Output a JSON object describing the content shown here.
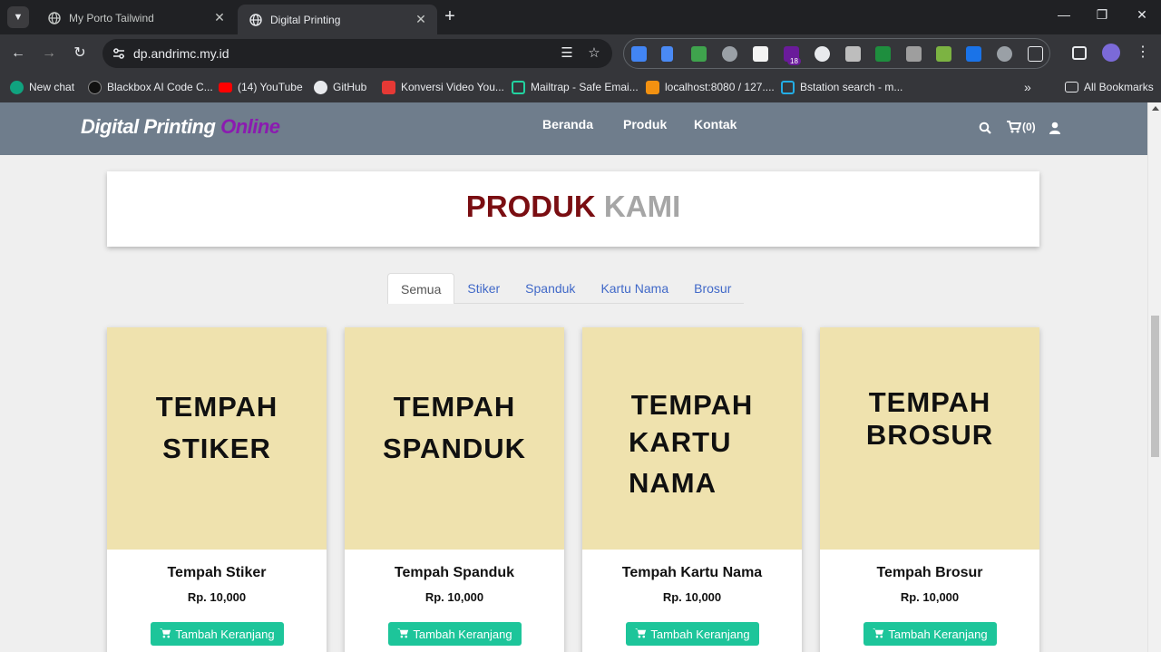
{
  "browser": {
    "tabs": [
      {
        "title": "My Porto Tailwind",
        "active": false
      },
      {
        "title": "Digital Printing",
        "active": true
      }
    ],
    "url": "dp.andrimc.my.id",
    "bookmarks": [
      {
        "label": "New chat",
        "color": "#10a37f"
      },
      {
        "label": "Blackbox AI Code C...",
        "color": "#111111"
      },
      {
        "label": "(14) YouTube",
        "color": "#ff0000"
      },
      {
        "label": "GitHub",
        "color": "#e8eaed"
      },
      {
        "label": "Konversi Video You...",
        "color": "#e53935"
      },
      {
        "label": "Mailtrap - Safe Emai...",
        "color": "#22d3a0"
      },
      {
        "label": "localhost:8080 / 127....",
        "color": "#f29111"
      },
      {
        "label": "Bstation search - m...",
        "color": "#23ade5"
      }
    ],
    "all_bookmarks_label": "All Bookmarks",
    "extension_badge": "18"
  },
  "site": {
    "brand_main": "Digital Printing",
    "brand_accent": "Online",
    "menu": [
      "Beranda",
      "Produk",
      "Kontak"
    ],
    "cart_label": "(0)",
    "section_title_1": "PRODUK",
    "section_title_2": "KAMI",
    "filters": [
      "Semua",
      "Stiker",
      "Spanduk",
      "Kartu Nama",
      "Brosur"
    ],
    "active_filter": "Semua",
    "products": [
      {
        "thumb_lines": [
          "TEMPAH",
          "STIKER"
        ],
        "name": "Tempah Stiker",
        "price": "Rp. 10,000",
        "button": "Tambah Keranjang"
      },
      {
        "thumb_lines": [
          "TEMPAH",
          "SPANDUK"
        ],
        "name": "Tempah Spanduk",
        "price": "Rp. 10,000",
        "button": "Tambah Keranjang"
      },
      {
        "thumb_lines": [
          "TEMPAH",
          "KARTU",
          "NAMA"
        ],
        "name": "Tempah Kartu Nama",
        "price": "Rp. 10,000",
        "button": "Tambah Keranjang"
      },
      {
        "thumb_lines": [
          "TEMPAH",
          "BROSUR"
        ],
        "name": "Tempah Brosur",
        "price": "Rp. 10,000",
        "button": "Tambah Keranjang"
      }
    ],
    "colors": {
      "navbar": "#6f7d8c",
      "accent_purple": "#8b1bb0",
      "title_red": "#7a0e12",
      "card_thumb": "#efe2ae",
      "button_green": "#1dc59a"
    }
  }
}
